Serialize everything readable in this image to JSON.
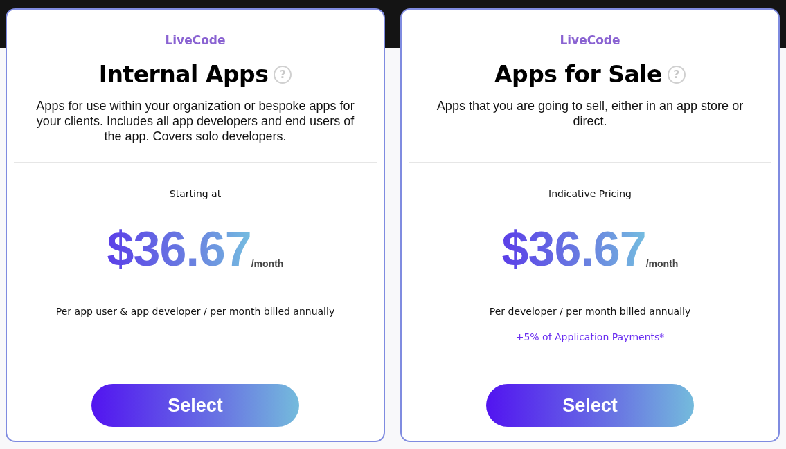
{
  "plans": [
    {
      "brand": "LiveCode",
      "title": "Internal Apps",
      "help_icon": "?",
      "description": "Apps for use within your organization or bespoke apps for your clients. Includes all app developers and end users of the app. Covers solo developers.",
      "price_label": "Starting at",
      "price": "$36.67",
      "period": "/month",
      "billing": "Per app user & app developer / per month billed annually",
      "button": "Select"
    },
    {
      "brand": "LiveCode",
      "title": "Apps for Sale",
      "help_icon": "?",
      "description": "Apps that you are going to sell, either in an app store or direct.",
      "price_label": "Indicative Pricing",
      "price": "$36.67",
      "period": "/month",
      "billing": "Per developer / per month billed annually",
      "note": "+5% of Application Payments*",
      "button": "Select"
    }
  ]
}
